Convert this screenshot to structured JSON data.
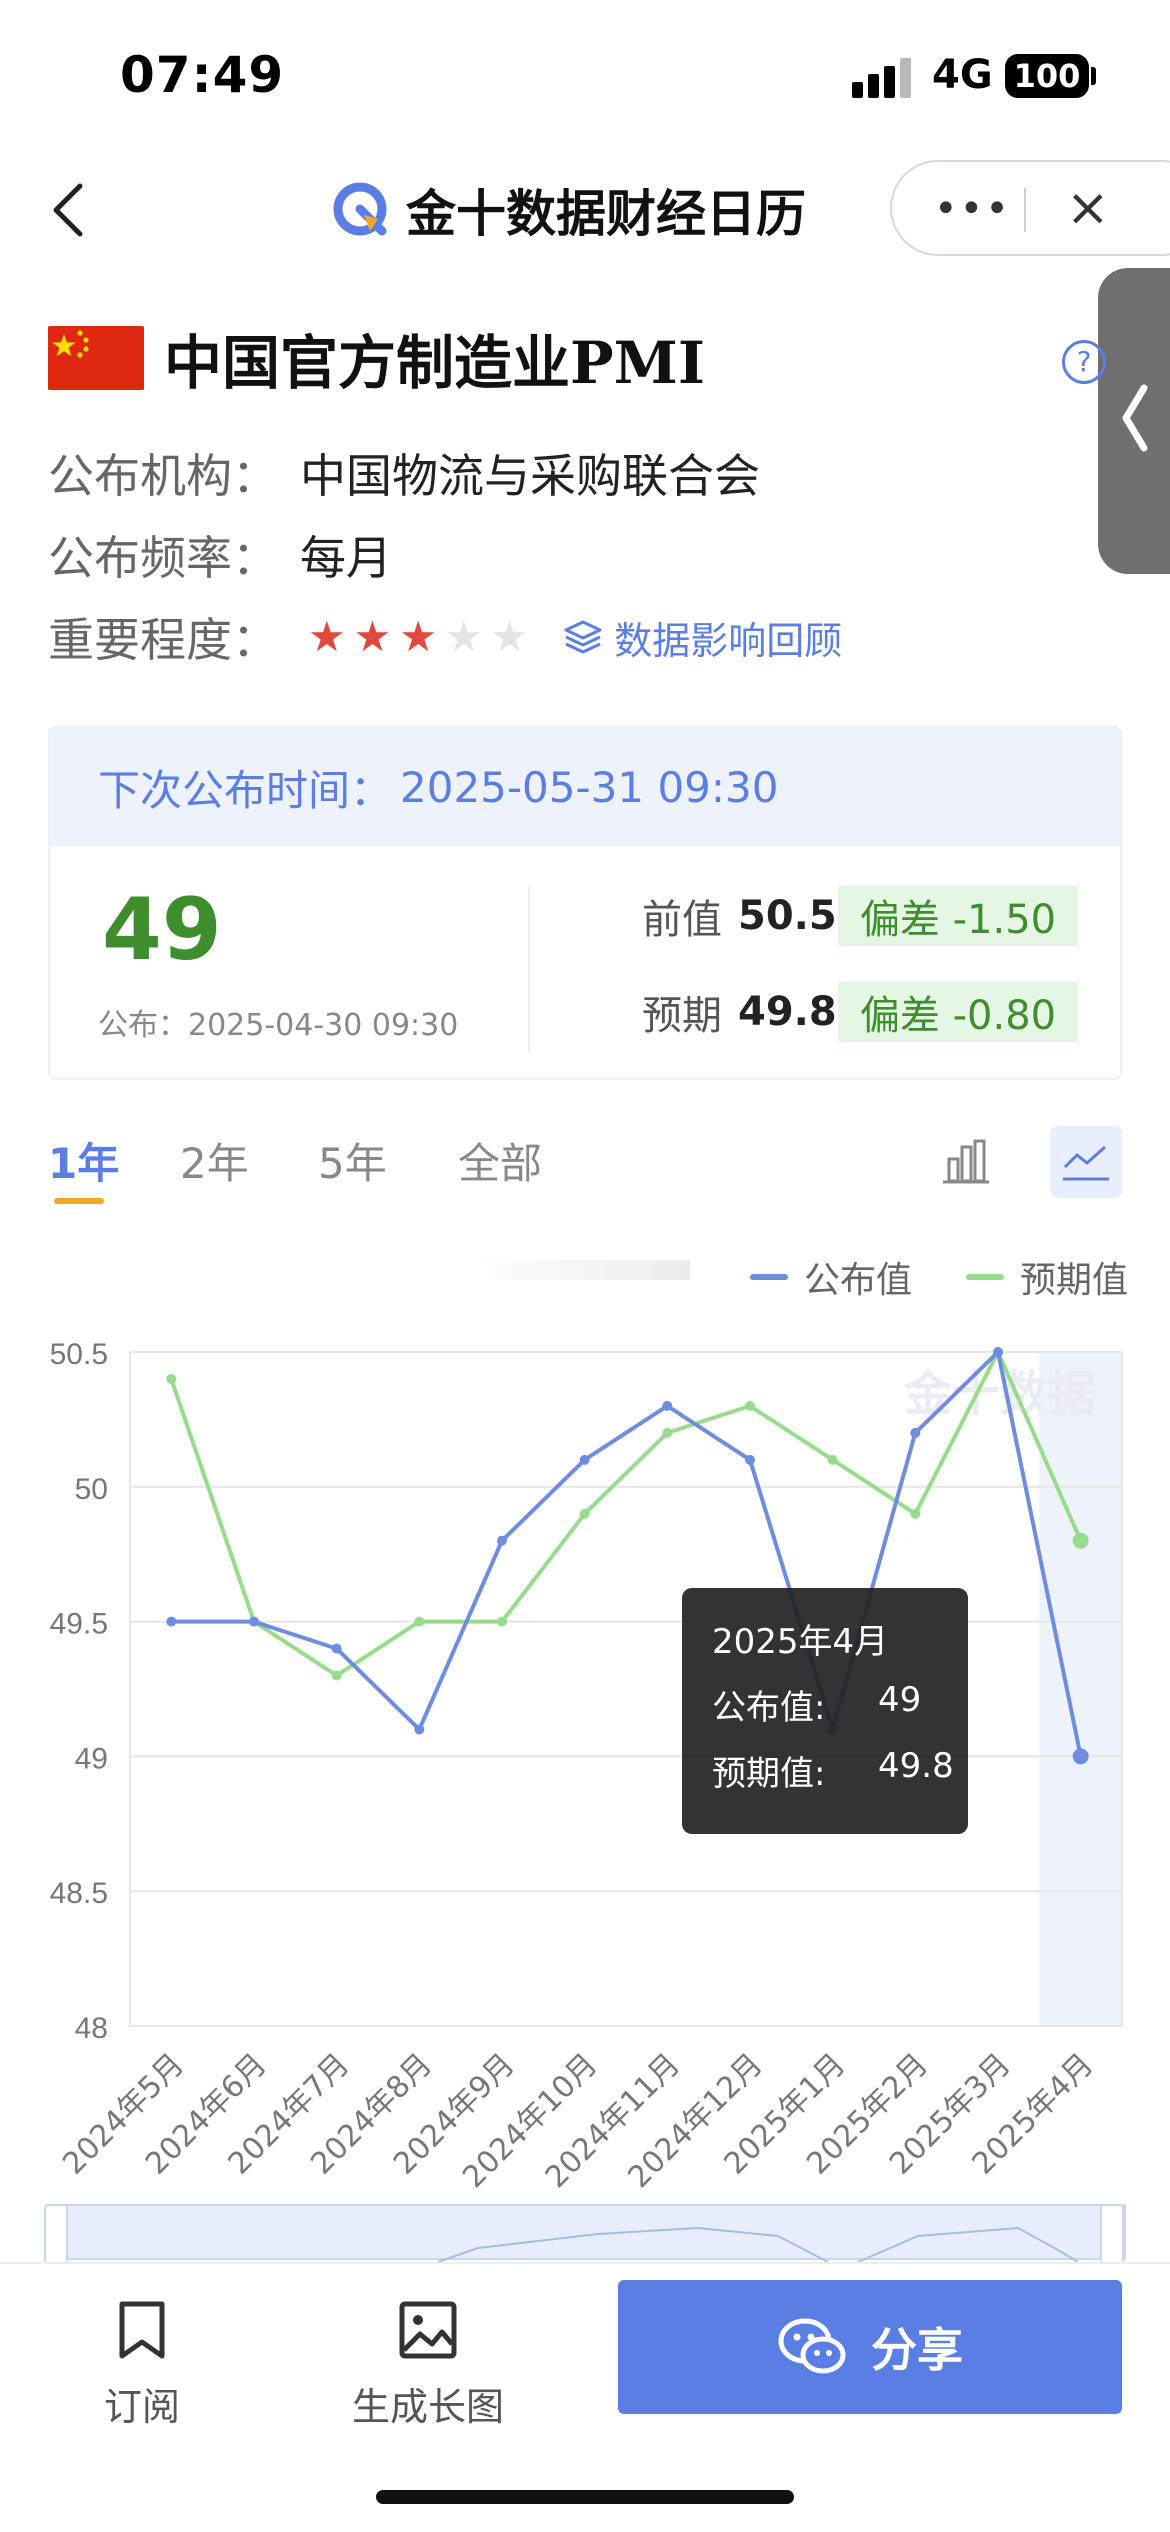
{
  "status_bar": {
    "time": "07:49",
    "network": "4G",
    "battery": "100"
  },
  "nav": {
    "title": "金十数据财经日历",
    "more_icon": "more-dots-icon",
    "close_icon": "close-icon"
  },
  "indicator": {
    "flag": "china-flag-icon",
    "title": "中国官方制造业PMI",
    "publisher_label": "公布机构：",
    "publisher": "中国物流与采购联合会",
    "frequency_label": "公布频率：",
    "frequency": "每月",
    "importance_label": "重要程度：",
    "importance_stars": 3,
    "importance_max": 5,
    "review_link": "数据影响回顾"
  },
  "release": {
    "next_label": "下次公布时间：",
    "next_time": "2025-05-31 09:30",
    "actual": "49",
    "published_at": "公布：2025-04-30 09:30",
    "previous_label": "前值",
    "previous": "50.5",
    "previous_dev": "偏差 -1.50",
    "forecast_label": "预期",
    "forecast": "49.8",
    "forecast_dev": "偏差 -0.80"
  },
  "period_tabs": [
    "1年",
    "2年",
    "5年",
    "全部"
  ],
  "active_period": "1年",
  "colors": {
    "accent": "#5b7ee5",
    "actual_series": "#6f8de0",
    "forecast_series": "#97dc8a",
    "positive": "#3f8e2e",
    "star": "#e0493c"
  },
  "chart_data": {
    "type": "line",
    "x": [
      "2024年5月",
      "2024年6月",
      "2024年7月",
      "2024年8月",
      "2024年9月",
      "2024年10月",
      "2024年11月",
      "2024年12月",
      "2025年1月",
      "2025年2月",
      "2025年3月",
      "2025年4月"
    ],
    "series": [
      {
        "name": "公布值",
        "values": [
          49.5,
          49.5,
          49.4,
          49.1,
          49.8,
          50.1,
          50.3,
          50.1,
          49.1,
          50.2,
          50.5,
          49.0
        ]
      },
      {
        "name": "预期值",
        "values": [
          50.4,
          49.5,
          49.3,
          49.5,
          49.5,
          49.9,
          50.2,
          50.3,
          50.1,
          49.9,
          50.5,
          49.8
        ]
      }
    ],
    "y_ticks": [
      "50.5",
      "50",
      "49.5",
      "49",
      "48.5",
      "48"
    ],
    "ylim": [
      48,
      50.5
    ],
    "grid": true,
    "legend_position": "top-right",
    "watermark": "金十数据",
    "highlighted_index": 11
  },
  "tooltip": {
    "title": "2025年4月",
    "actual_label": "公布值:",
    "actual": "49",
    "forecast_label": "预期值:",
    "forecast": "49.8"
  },
  "bottom_bar": {
    "subscribe": "订阅",
    "long_image": "生成长图",
    "share": "分享"
  }
}
